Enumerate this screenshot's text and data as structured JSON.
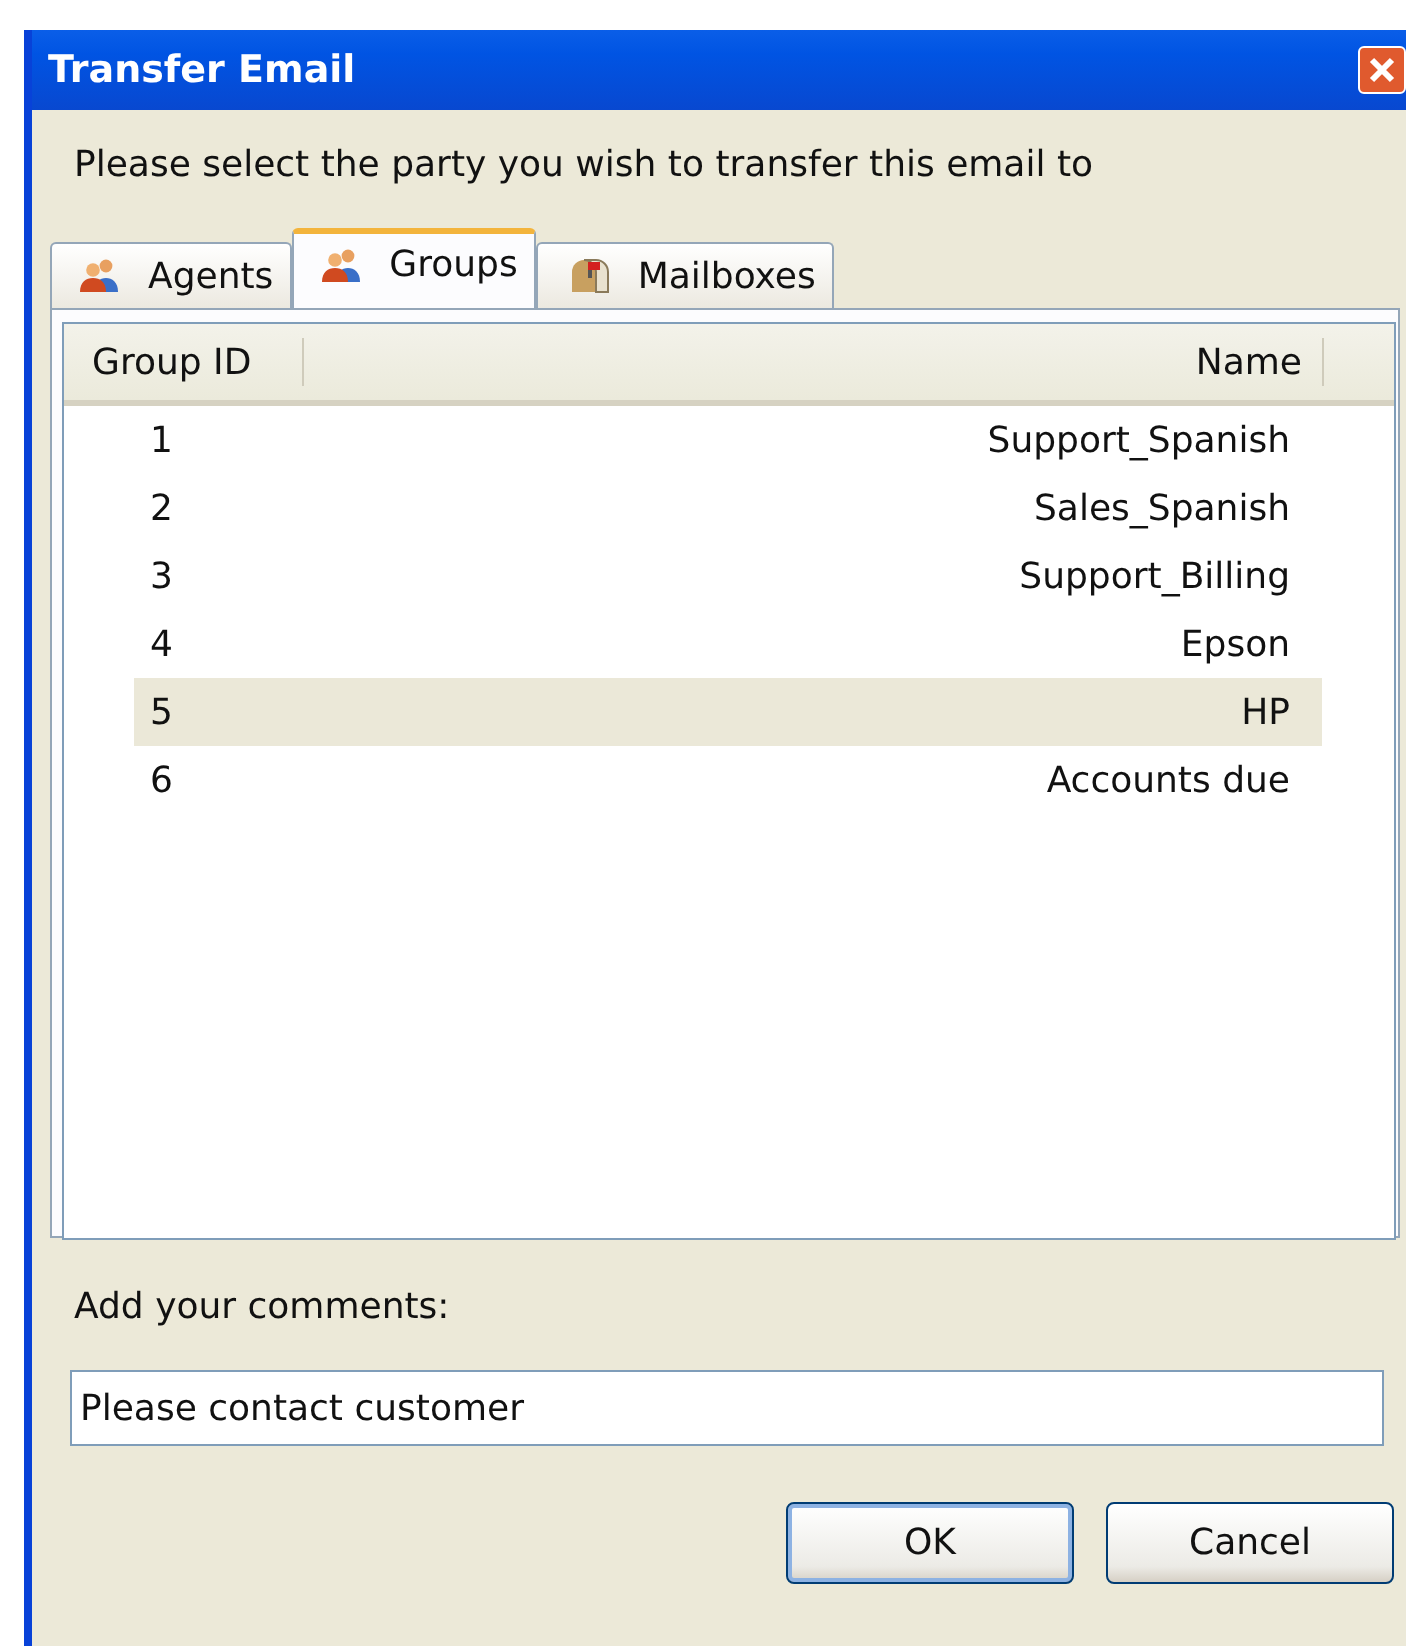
{
  "window": {
    "title": "Transfer Email"
  },
  "prompt": "Please select the party you wish to transfer this email to",
  "tabs": [
    {
      "label": "Agents",
      "kind": "people",
      "selected": false
    },
    {
      "label": "Groups",
      "kind": "people",
      "selected": true
    },
    {
      "label": "Mailboxes",
      "kind": "mailbox",
      "selected": false
    }
  ],
  "table": {
    "columns": [
      "Group ID",
      "Name"
    ],
    "rows": [
      {
        "id": "1",
        "name": "Support_Spanish",
        "selected": false
      },
      {
        "id": "2",
        "name": "Sales_Spanish",
        "selected": false
      },
      {
        "id": "3",
        "name": "Support_Billing",
        "selected": false
      },
      {
        "id": "4",
        "name": "Epson",
        "selected": false
      },
      {
        "id": "5",
        "name": "HP",
        "selected": true
      },
      {
        "id": "6",
        "name": "Accounts due",
        "selected": false
      }
    ]
  },
  "comments": {
    "label": "Add your comments:",
    "value": "Please contact customer"
  },
  "buttons": [
    {
      "label": "OK",
      "default": true
    },
    {
      "label": "Cancel",
      "default": false
    }
  ]
}
